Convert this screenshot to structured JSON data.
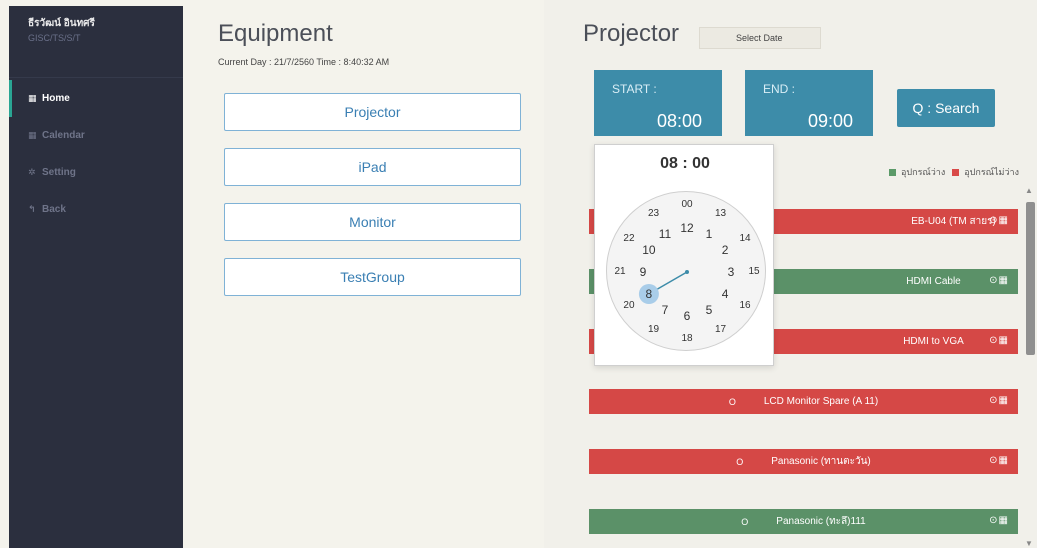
{
  "sidebar": {
    "user_name": "ธีรวัฒน์ อินทศรี",
    "user_code": "GISC/TS/S/T",
    "items": [
      {
        "label": "Home",
        "icon": "grid-icon",
        "active": true
      },
      {
        "label": "Calendar",
        "icon": "calendar-icon",
        "active": false
      },
      {
        "label": "Setting",
        "icon": "gear-icon",
        "active": false
      },
      {
        "label": "Back",
        "icon": "reply-icon",
        "active": false
      }
    ]
  },
  "equipment": {
    "title": "Equipment",
    "datetime": "Current  Day :  21/7/2560  Time :  8:40:32 AM",
    "categories": [
      "Projector",
      "iPad",
      "Monitor",
      "TestGroup"
    ]
  },
  "projector": {
    "title": "Projector",
    "date_placeholder": "Select Date",
    "start_label": "START :",
    "start_value": "08:00",
    "end_label": "END :",
    "end_value": "09:00",
    "search_label": "Q : Search",
    "legend_available": "อุปกรณ์ว่าง",
    "legend_unavailable": "อุปกรณ์ไม่ว่าง",
    "colors": {
      "available": "#5b9168",
      "unavailable": "#d54846",
      "accent": "#3d8ca9"
    },
    "rows": [
      {
        "label": "EB-U04 (TM สายร)",
        "status": "unavailable",
        "circle": ""
      },
      {
        "label": "HDMI Cable",
        "status": "available",
        "circle": ""
      },
      {
        "label": "HDMI to VGA",
        "status": "unavailable",
        "circle": ""
      },
      {
        "label": "LCD Monitor Spare (A 11)",
        "status": "unavailable",
        "circle": "O"
      },
      {
        "label": "Panasonic (ทานตะวัน)",
        "status": "unavailable",
        "circle": "O"
      },
      {
        "label": "Panasonic (ทะลึ)111",
        "status": "available",
        "circle": "O"
      }
    ],
    "row_actions": "⊙▦"
  },
  "clock": {
    "header": "08 : 00",
    "selected_hour": "8",
    "outer_hours": [
      "00",
      "13",
      "14",
      "15",
      "16",
      "17",
      "18",
      "19",
      "20",
      "21",
      "22",
      "23"
    ],
    "inner_hours": [
      "12",
      "1",
      "2",
      "3",
      "4",
      "5",
      "6",
      "7",
      "8",
      "9",
      "10",
      "11"
    ]
  }
}
